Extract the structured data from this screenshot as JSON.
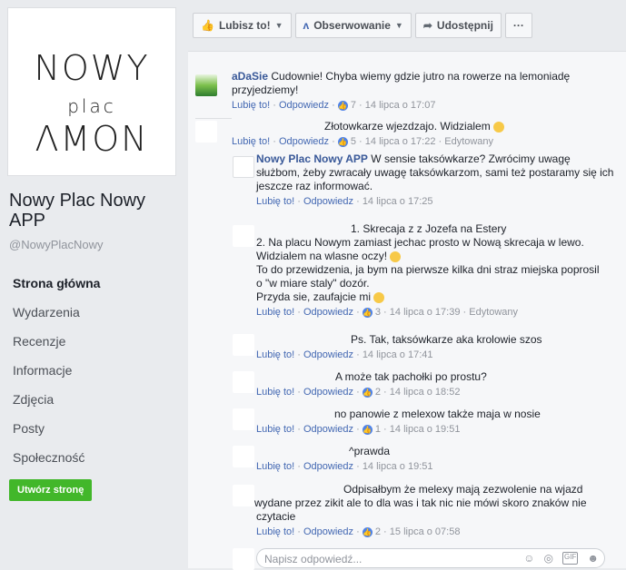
{
  "sidebar": {
    "logo": [
      "NOWY",
      "plac",
      "ΛMON"
    ],
    "page_name": "Nowy Plac Nowy APP",
    "handle": "@NowyPlacNowy",
    "nav": [
      "Strona główna",
      "Wydarzenia",
      "Recenzje",
      "Informacje",
      "Zdjęcia",
      "Posty",
      "Społeczność"
    ],
    "create_button": "Utwórz stronę"
  },
  "toolbar": {
    "like": "Lubisz to!",
    "follow": "Obserwowanie",
    "share": "Udostępnij",
    "more": "···"
  },
  "comments": [
    {
      "author": "aDaSie",
      "text": "Cudownie! Chyba wiemy gdzie jutro na rowerze na lemoniadę przyjedziemy!",
      "likes": "7",
      "time": "14 lipca o 17:07",
      "edited": ""
    },
    {
      "author": "",
      "text": "Złotowkarze wjezdzajo. Widzialem",
      "likes": "5",
      "time": "14 lipca o 17:22",
      "edited": "Edytowany"
    },
    {
      "author": "Nowy Plac Nowy APP",
      "text": "W sensie taksówkarze? Zwrócimy uwagę służbom, żeby zwracały uwagę taksówkarzom, sami też postaramy się ich jeszcze raz informować.",
      "likes": "",
      "time": "14 lipca o 17:25",
      "edited": ""
    },
    {
      "author": "",
      "text_lines": [
        "1. Skrecaja z z Jozefa na Estery",
        "2. Na placu Nowym zamiast jechac prosto w Nową skrecaja w lewo.",
        "Widzialem na wlasne oczy!",
        "To do przewidzenia, ja bym na pierwsze kilka dni straz miejska poprosil",
        "o \"w miare staly\" dozór.",
        "Przyda sie, zaufajcie mi"
      ],
      "likes": "3",
      "time": "14 lipca o 17:39",
      "edited": "Edytowany"
    },
    {
      "author": "",
      "text": "Ps. Tak, taksówkarze aka krolowie szos",
      "likes": "",
      "time": "14 lipca o 17:41",
      "edited": ""
    },
    {
      "author": "",
      "text": "A może tak pachołki po prostu?",
      "likes": "2",
      "time": "14 lipca o 18:52",
      "edited": ""
    },
    {
      "author": "",
      "text": "no panowie z melexow także maja w nosie",
      "likes": "1",
      "time": "14 lipca o 19:51",
      "edited": ""
    },
    {
      "author": "",
      "text": "^prawda",
      "likes": "",
      "time": "14 lipca o 19:51",
      "edited": ""
    },
    {
      "author": "",
      "text_lines": [
        "Odpisałbym że melexy mają zezwolenie na wjazd",
        "wydane przez zikit ale to dla was i tak nic nie mówi skoro znaków nie",
        "czytacie"
      ],
      "likes": "2",
      "time": "15 lipca o 07:58",
      "edited": ""
    }
  ],
  "actions": {
    "like": "Lubię to!",
    "reply": "Odpowiedz"
  },
  "reply_box": {
    "placeholder": "Napisz odpowiedź...",
    "icons": [
      "emoji-icon",
      "camera-icon",
      "gif-icon",
      "sticker-icon"
    ]
  },
  "colors": {
    "link": "#4267b2",
    "create_button": "#42b72a",
    "like_badge": "#4f83e8"
  }
}
